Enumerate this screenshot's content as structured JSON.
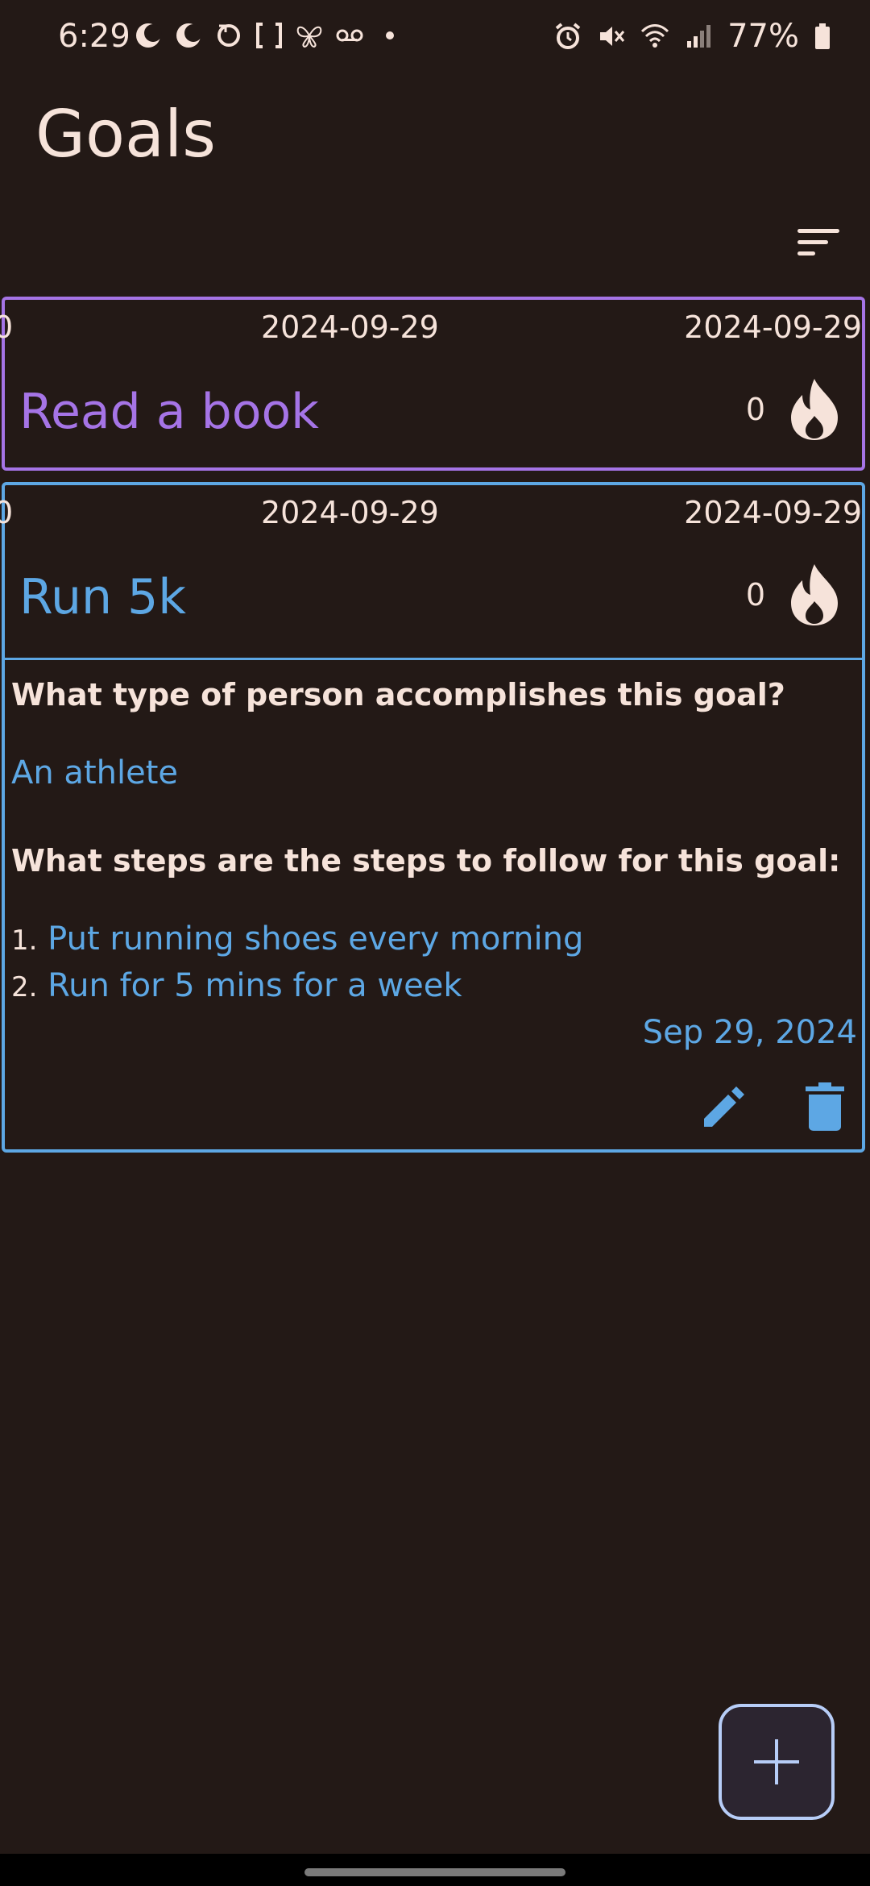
{
  "statusbar": {
    "time": "6:29",
    "battery": "77%"
  },
  "header": {
    "title": "Goals"
  },
  "goals": [
    {
      "counter": "0",
      "start_date": "2024-09-29",
      "end_date": "2024-09-29",
      "name": "Read a book",
      "streak": "0",
      "color": "#a574e6"
    },
    {
      "counter": "0",
      "start_date": "2024-09-29",
      "end_date": "2024-09-29",
      "name": "Run 5k",
      "streak": "0",
      "color": "#5da7e4",
      "question_identity": "What type of person accomplishes this goal?",
      "identity": "An athlete",
      "question_steps": "What steps are the steps to follow for this goal:",
      "steps": [
        {
          "num": "1.",
          "text": "Put running shoes every morning"
        },
        {
          "num": "2.",
          "text": "Run for 5 mins for a week"
        }
      ],
      "created": "Sep 29, 2024"
    }
  ],
  "icons": {
    "sort": "sort-icon",
    "streak": "flame-icon",
    "edit": "pencil-icon",
    "delete": "trash-icon",
    "add": "plus-icon"
  },
  "colors": {
    "background": "#231916",
    "text": "#f6e3da",
    "purple": "#a574e6",
    "blue": "#5da7e4",
    "fab_border": "#b7cdf7"
  }
}
